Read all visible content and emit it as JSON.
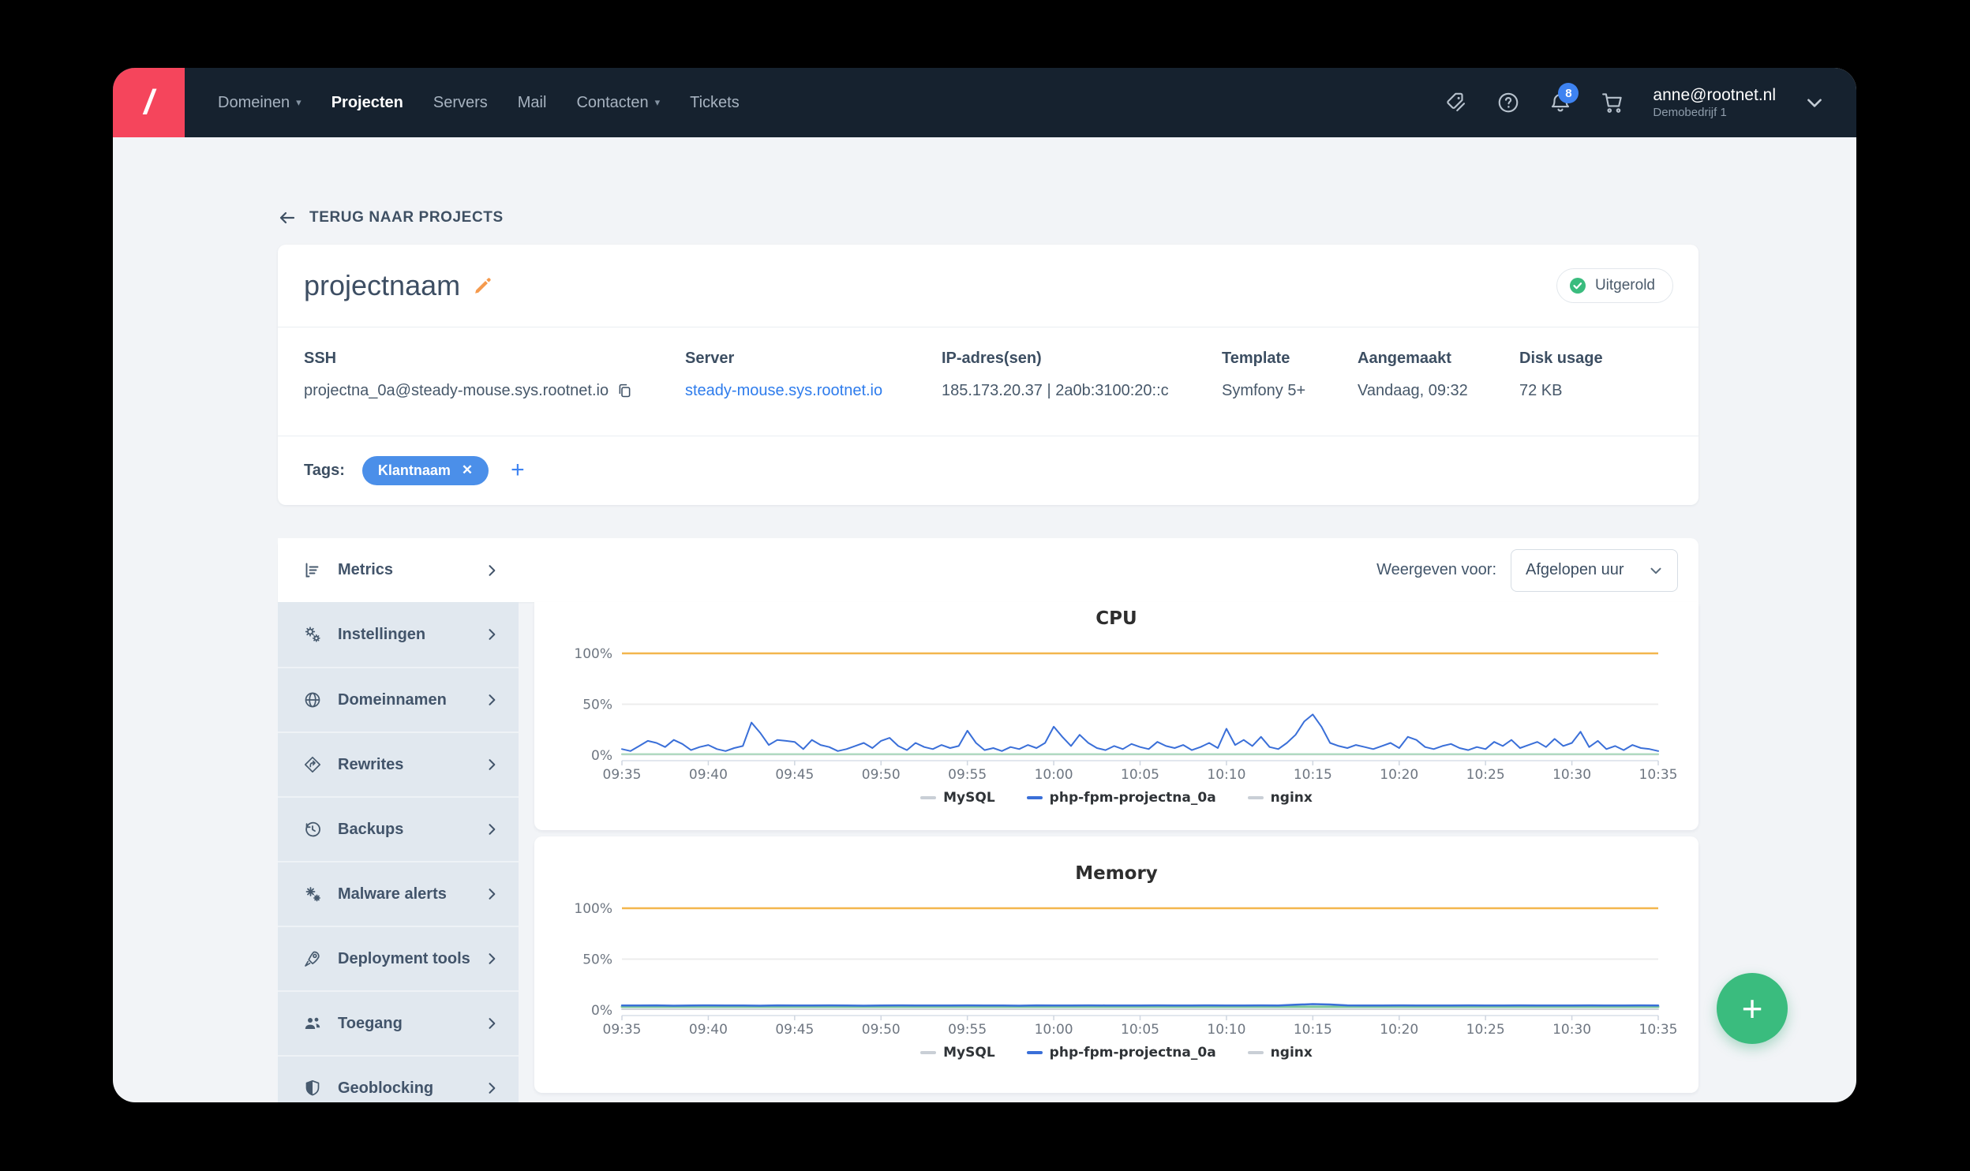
{
  "navbar": {
    "brand": "/",
    "items": [
      {
        "label": "Domeinen",
        "dropdown": true,
        "active": false
      },
      {
        "label": "Projecten",
        "dropdown": false,
        "active": true
      },
      {
        "label": "Servers",
        "dropdown": false,
        "active": false
      },
      {
        "label": "Mail",
        "dropdown": false,
        "active": false
      },
      {
        "label": "Contacten",
        "dropdown": true,
        "active": false
      },
      {
        "label": "Tickets",
        "dropdown": false,
        "active": false
      }
    ],
    "notification_count": "8",
    "user_email": "anne@rootnet.nl",
    "user_company": "Demobedrijf 1"
  },
  "back_link": {
    "label": "TERUG NAAR PROJECTS"
  },
  "project": {
    "title": "projectnaam",
    "status_badge": "Uitgerold",
    "status_color": "#3abc7e",
    "info": [
      {
        "label": "SSH",
        "value": "projectna_0a@steady-mouse.sys.rootnet.io",
        "copyable": true,
        "link": false
      },
      {
        "label": "Server",
        "value": "steady-mouse.sys.rootnet.io",
        "copyable": false,
        "link": true
      },
      {
        "label": "IP-adres(sen)",
        "value": "185.173.20.37 | 2a0b:3100:20::c",
        "copyable": false,
        "link": false
      },
      {
        "label": "Template",
        "value": "Symfony 5+",
        "copyable": false,
        "link": false
      },
      {
        "label": "Aangemaakt",
        "value": "Vandaag, 09:32",
        "copyable": false,
        "link": false
      },
      {
        "label": "Disk usage",
        "value": "72 KB",
        "copyable": false,
        "link": false
      }
    ],
    "tags_label": "Tags:",
    "tags": [
      "Klantnaam"
    ],
    "tag_color": "#4b8fe9"
  },
  "sidebar": {
    "items": [
      {
        "label": "Metrics",
        "icon": "metrics",
        "active": true
      },
      {
        "label": "Instellingen",
        "icon": "gears",
        "active": false
      },
      {
        "label": "Domeinnamen",
        "icon": "globe",
        "active": false
      },
      {
        "label": "Rewrites",
        "icon": "rewrites",
        "active": false
      },
      {
        "label": "Backups",
        "icon": "history",
        "active": false
      },
      {
        "label": "Malware alerts",
        "icon": "malware",
        "active": false
      },
      {
        "label": "Deployment tools",
        "icon": "rocket",
        "active": false
      },
      {
        "label": "Toegang",
        "icon": "users",
        "active": false
      },
      {
        "label": "Geoblocking",
        "icon": "shield",
        "active": false
      }
    ]
  },
  "metrics": {
    "filter_label": "Weergeven voor:",
    "filter_value": "Afgelopen uur"
  },
  "chart_data": [
    {
      "type": "line",
      "title": "CPU",
      "ylabel": "percent",
      "ylim": [
        0,
        120
      ],
      "y_ticks": [
        {
          "v": 0,
          "label": "0%"
        },
        {
          "v": 50,
          "label": "50%"
        },
        {
          "v": 100,
          "label": "100%"
        }
      ],
      "x_ticks": [
        "09:35",
        "09:40",
        "09:45",
        "09:50",
        "09:55",
        "10:00",
        "10:05",
        "10:10",
        "10:15",
        "10:20",
        "10:25",
        "10:30",
        "10:35"
      ],
      "threshold_line": {
        "value": 100,
        "color": "#f3b64d"
      },
      "grid": "horizontal",
      "legend_position": "bottom",
      "legend": [
        {
          "name": "MySQL",
          "color": "#c9cfd6"
        },
        {
          "name": "php-fpm-projectna_0a",
          "color": "#3a6fd8"
        },
        {
          "name": "nginx",
          "color": "#c9cfd6"
        }
      ],
      "series": [
        {
          "name": "MySQL",
          "color": "#cfd4da",
          "width": 2,
          "values": [
            0.6,
            0.6
          ]
        },
        {
          "name": "nginx",
          "color": "#a9d9bb",
          "width": 2,
          "values": [
            1.1,
            1.1
          ]
        },
        {
          "name": "php-fpm-projectna_0a",
          "color": "#3a6fd8",
          "width": 2,
          "values": [
            6,
            4,
            9,
            14,
            12,
            8,
            15,
            11,
            5,
            8,
            10,
            6,
            4,
            7,
            9,
            32,
            22,
            10,
            15,
            14,
            13,
            6,
            15,
            10,
            8,
            4,
            6,
            9,
            12,
            7,
            14,
            17,
            9,
            5,
            12,
            8,
            6,
            10,
            7,
            9,
            24,
            12,
            5,
            7,
            4,
            8,
            6,
            10,
            7,
            12,
            28,
            18,
            9,
            20,
            12,
            7,
            5,
            9,
            6,
            11,
            8,
            6,
            13,
            9,
            7,
            10,
            5,
            8,
            12,
            7,
            26,
            10,
            15,
            9,
            18,
            8,
            6,
            12,
            20,
            33,
            40,
            28,
            12,
            9,
            7,
            10,
            8,
            6,
            9,
            12,
            7,
            18,
            15,
            8,
            6,
            9,
            11,
            7,
            5,
            8,
            6,
            13,
            9,
            15,
            7,
            10,
            13,
            8,
            16,
            9,
            12,
            23,
            8,
            14,
            6,
            9,
            5,
            10,
            7,
            6,
            4
          ]
        }
      ]
    },
    {
      "type": "line",
      "title": "Memory",
      "ylabel": "percent",
      "ylim": [
        0,
        120
      ],
      "y_ticks": [
        {
          "v": 0,
          "label": "0%"
        },
        {
          "v": 50,
          "label": "50%"
        },
        {
          "v": 100,
          "label": "100%"
        }
      ],
      "x_ticks": [
        "09:35",
        "09:40",
        "09:45",
        "09:50",
        "09:55",
        "10:00",
        "10:05",
        "10:10",
        "10:15",
        "10:20",
        "10:25",
        "10:30",
        "10:35"
      ],
      "threshold_line": {
        "value": 100,
        "color": "#f3b64d"
      },
      "grid": "horizontal",
      "legend_position": "bottom",
      "legend": [
        {
          "name": "MySQL",
          "color": "#c9cfd6"
        },
        {
          "name": "php-fpm-projectna_0a",
          "color": "#3a6fd8"
        },
        {
          "name": "nginx",
          "color": "#c9cfd6"
        }
      ],
      "series": [
        {
          "name": "MySQL",
          "color": "#cfd4da",
          "width": 2,
          "values": [
            0.8,
            0.8
          ]
        },
        {
          "name": "nginx",
          "color": "#7cc79a",
          "width": 3,
          "values": [
            3.2,
            3.2
          ]
        },
        {
          "name": "php-fpm-projectna_0a",
          "color": "#3a6fd8",
          "width": 2.5,
          "values": [
            4.5,
            4.4,
            4.6,
            4.3,
            4.5,
            4.6,
            4.4,
            4.5,
            4.3,
            4.6,
            4.5,
            4.4,
            4.6,
            4.5,
            4.3,
            4.4,
            4.6,
            4.5,
            4.4,
            4.5,
            4.6,
            4.4,
            4.5,
            4.3,
            4.6,
            4.5,
            4.4,
            4.6,
            4.5,
            4.4,
            4.5,
            4.6,
            4.4,
            4.5,
            4.6,
            4.5,
            4.4,
            4.6,
            4.5,
            5.2,
            5.8,
            5.4,
            4.6,
            4.5,
            4.4,
            4.6,
            4.5,
            4.4,
            4.5,
            4.6,
            4.4,
            4.5,
            4.6,
            4.5,
            4.4,
            4.5,
            4.6,
            4.4,
            4.5,
            4.6,
            4.5
          ]
        }
      ]
    }
  ]
}
